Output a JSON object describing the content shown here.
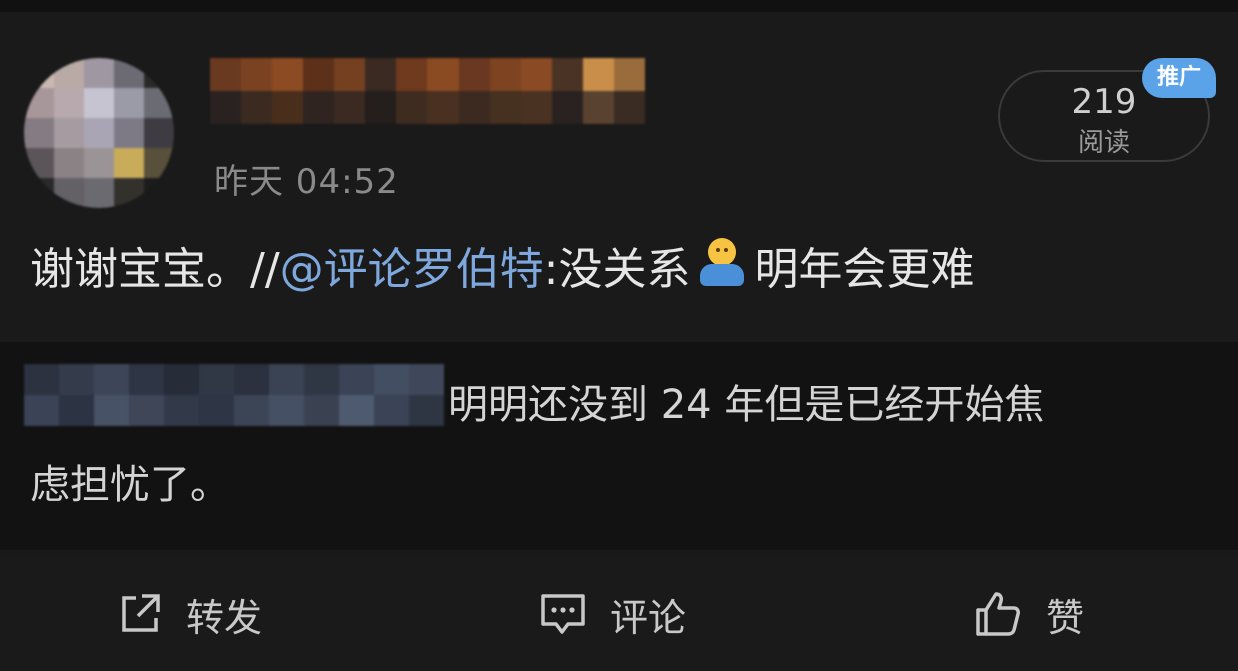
{
  "post": {
    "timestamp": "昨天 04:52",
    "reads": {
      "count": "219",
      "label": "阅读"
    },
    "promo_badge": "推广",
    "text_prefix": "谢谢宝宝。//",
    "mention": "@评论罗伯特",
    "text_middle": ":没关系",
    "emoji": "person-shrug-emoji",
    "text_suffix": "明年会更难"
  },
  "comment": {
    "line1": "明明还没到 24 年但是已经开始焦",
    "line2": "虑担忧了。"
  },
  "actions": {
    "repost_label": "转发",
    "comment_label": "评论",
    "like_label": "赞"
  },
  "colors": {
    "background": "#1a1a1a",
    "comment_background": "#121212",
    "mention": "#7ea8dd",
    "promo_badge": "#5aa3e8"
  }
}
